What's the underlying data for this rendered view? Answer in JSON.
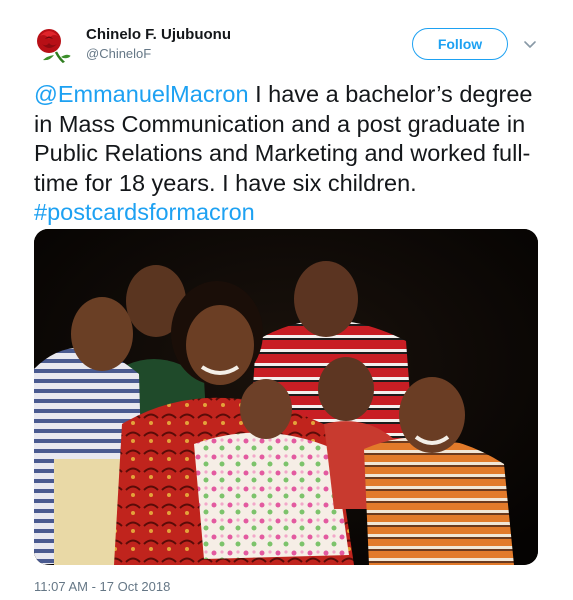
{
  "author": {
    "name": "Chinelo F. Ujubuonu",
    "handle": "@ChineloF",
    "avatar_icon": "rose-icon"
  },
  "actions": {
    "follow_label": "Follow",
    "menu_icon": "chevron-down-icon"
  },
  "tweet": {
    "mention": "@EmmanuelMacron",
    "body": " I have a bachelor’s degree in Mass Communication and a post graduate in Public Relations and Marketing and worked full-time for 18 years. I have six children. ",
    "hashtag": "#postcardsformacron"
  },
  "timestamp": "11:07 AM - 17 Oct 2018",
  "colors": {
    "accent": "#1da1f2",
    "text": "#14171a",
    "secondary": "#657786"
  }
}
